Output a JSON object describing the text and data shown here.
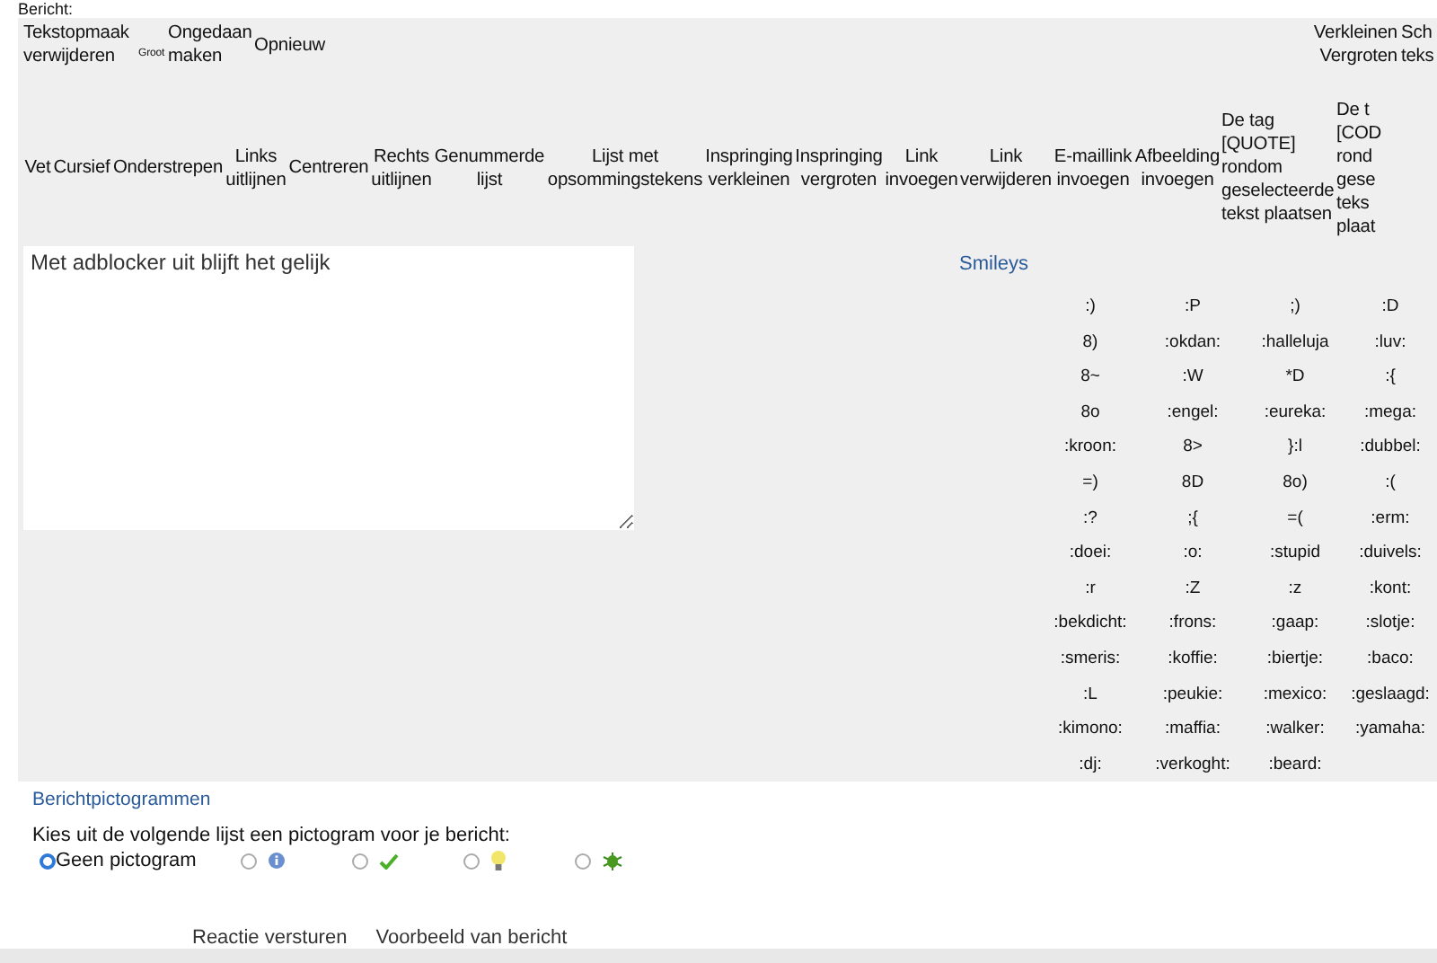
{
  "section_label": "Bericht:",
  "toolbar": {
    "row_1": [
      {
        "label": "Tekstopmaak verwijderen",
        "kind": "normal"
      },
      {
        "label": "Groot",
        "kind": "small"
      },
      {
        "label": "Ongedaan maken",
        "kind": "normal"
      },
      {
        "label": "Opnieuw",
        "kind": "normal"
      }
    ],
    "size_buttons": [
      "Verkleinen",
      "Vergroten"
    ],
    "row_1_cut": "Sch teks",
    "row_2": [
      "Vet",
      "Cursief",
      "Onderstrepen",
      "Links uitlijnen",
      "Centreren",
      "Rechts uitlijnen",
      "Genummerde lijst",
      "Lijst met opsommingstekens",
      "Inspringing verkleinen",
      "Inspringing vergroten",
      "Link invoegen",
      "Link verwijderen",
      "E-maillink invoegen",
      "Afbeelding invoegen",
      "De tag [QUOTE] rondom geselecteerde tekst plaatsen",
      "De t [COD rond gese teks plaat"
    ]
  },
  "editor": {
    "value": "Met adblocker uit blijft het gelijk"
  },
  "smileys": {
    "title": "Smileys",
    "items": [
      ":)",
      ":P",
      ";)",
      ":D",
      "8)",
      ":okdan:",
      ":halleluja",
      ":luv:",
      "8~",
      ":W",
      "*D",
      ":{",
      "8o",
      ":engel:",
      ":eureka:",
      ":mega:",
      ":kroon:",
      "8>",
      "}:l",
      ":dubbel:",
      "=)",
      "8D",
      "8o)",
      ":(",
      ":?",
      ";{",
      "=(",
      ":erm:",
      ":doei:",
      ":o:",
      ":stupid",
      ":duivels:",
      ":r",
      ":Z",
      ":z",
      ":kont:",
      ":bekdicht:",
      ":frons:",
      ":gaap:",
      ":slotje:",
      ":smeris:",
      ":koffie:",
      ":biertje:",
      ":baco:",
      ":L",
      ":peukie:",
      ":mexico:",
      ":geslaagd:",
      ":kimono:",
      ":maffia:",
      ":walker:",
      ":yamaha:",
      ":dj:",
      ":verkoght:",
      ":beard:"
    ]
  },
  "pictograms": {
    "title": "Berichtpictogrammen",
    "prompt": "Kies uit de volgende lijst een pictogram voor je bericht:",
    "options": [
      {
        "kind": "none",
        "label": "Geen pictogram",
        "selected": true
      },
      {
        "kind": "info",
        "selected": false
      },
      {
        "kind": "check",
        "selected": false
      },
      {
        "kind": "bulb",
        "selected": false
      },
      {
        "kind": "bug",
        "selected": false
      }
    ]
  },
  "actions": [
    "Reactie versturen",
    "Voorbeeld van bericht"
  ]
}
